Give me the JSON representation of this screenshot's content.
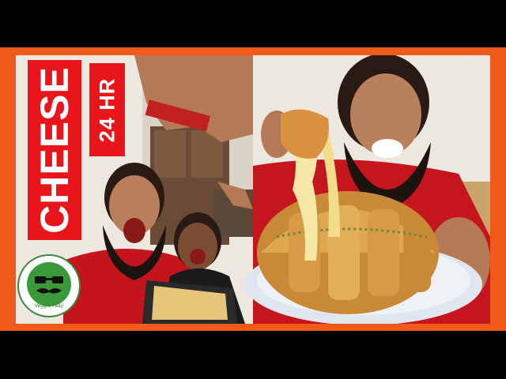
{
  "thumbnail": {
    "badge_main": "CHEESE",
    "badge_sub": "24 HR",
    "logo_text": "Veggie Paaji",
    "colors": {
      "frame": "#f25a1c",
      "badge": "#e8151b",
      "logo_green": "#3a8a3a"
    }
  }
}
